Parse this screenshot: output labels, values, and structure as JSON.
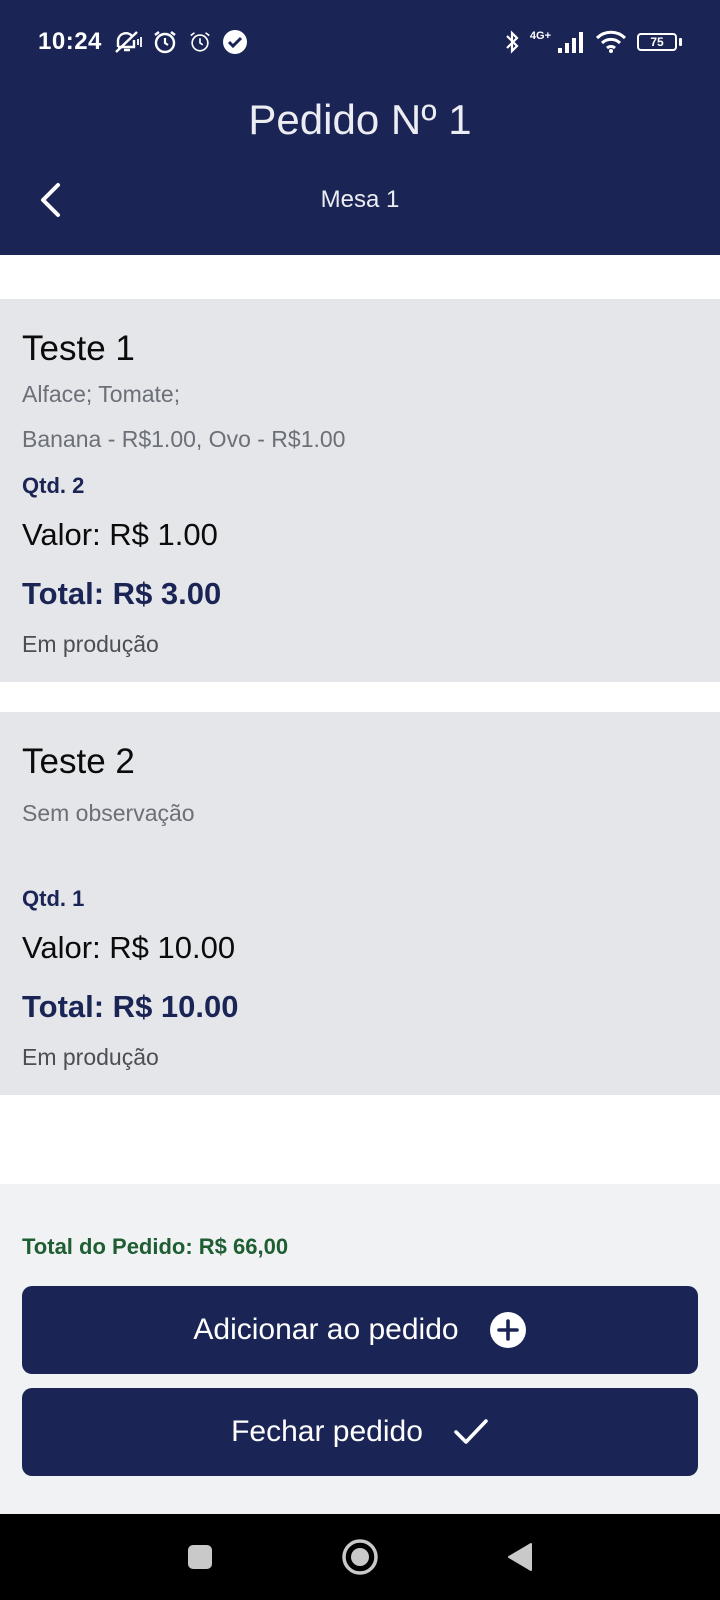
{
  "status_bar": {
    "time": "10:24",
    "network_label": "4G+",
    "battery": "75",
    "icons": [
      "mute-icon",
      "alarm-icon",
      "alarm-icon",
      "check-circle-icon",
      "bluetooth-icon",
      "signal-icon",
      "wifi-icon",
      "battery-icon"
    ]
  },
  "header": {
    "title": "Pedido Nº 1",
    "subtitle": "Mesa 1",
    "back_icon": "chevron-left-icon"
  },
  "items": [
    {
      "name": "Teste 1",
      "obs_line1": " Alface; Tomate;",
      "obs_line2": "Banana - R$1.00, Ovo - R$1.00",
      "qty": "Qtd. 2",
      "value": "Valor: R$ 1.00",
      "total": "Total: R$ 3.00",
      "status": "Em produção"
    },
    {
      "name": "Teste 2",
      "obs_line1": "Sem observação",
      "qty": "Qtd. 1",
      "value": "Valor: R$ 10.00",
      "total": "Total: R$ 10.00",
      "status": "Em produção"
    }
  ],
  "footer": {
    "order_total": "Total do Pedido: R$ 66,00",
    "add_button": "Adicionar ao pedido",
    "close_button": "Fechar pedido"
  },
  "colors": {
    "primary": "#1a2556",
    "card_bg": "#e5e6ea",
    "total_green": "#1f5d33"
  }
}
